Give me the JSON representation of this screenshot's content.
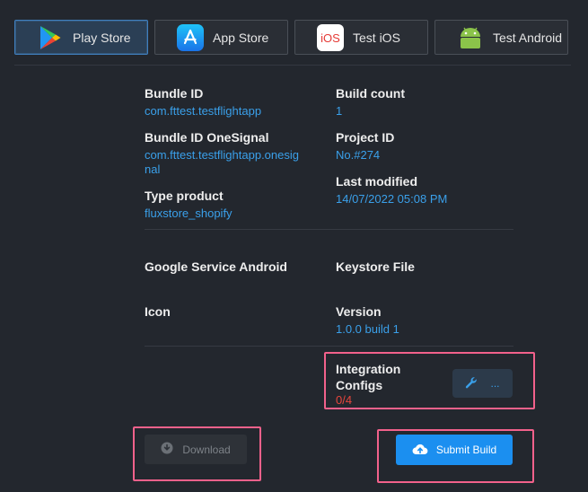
{
  "tabs": [
    {
      "label": "Play Store",
      "icon": "play-store-icon",
      "active": true
    },
    {
      "label": "App Store",
      "icon": "app-store-icon",
      "active": false
    },
    {
      "label": "Test iOS",
      "icon": "ios-icon",
      "active": false
    },
    {
      "label": "Test Android",
      "icon": "android-icon",
      "active": false
    }
  ],
  "ios_icon_text": "iOS",
  "info": {
    "bundle_id": {
      "label": "Bundle ID",
      "value": "com.fttest.testflightapp"
    },
    "build_count": {
      "label": "Build count",
      "value": "1"
    },
    "bundle_onesignal": {
      "label": "Bundle ID OneSignal",
      "value_line1": "com.fttest.testflightapp.onesig",
      "value_line2": "nal"
    },
    "project_id": {
      "label": "Project ID",
      "value": "No.#274"
    },
    "last_modified": {
      "label": "Last modified",
      "value": "14/07/2022 05:08 PM"
    },
    "type_product": {
      "label": "Type product",
      "value": "fluxstore_shopify"
    },
    "google_service": {
      "label": "Google Service Android"
    },
    "keystore": {
      "label": "Keystore File"
    },
    "icon": {
      "label": "Icon"
    },
    "version": {
      "label": "Version",
      "value": "1.0.0 build 1"
    },
    "integration": {
      "label_line1": "Integration",
      "label_line2": "Configs",
      "value": "0/4",
      "button_text": "..."
    }
  },
  "buttons": {
    "download": "Download",
    "submit": "Submit Build"
  },
  "colors": {
    "accent": "#1b8ff0",
    "value_text": "#3aa0ea",
    "warning": "#e8453c",
    "highlight": "#f2618b"
  }
}
